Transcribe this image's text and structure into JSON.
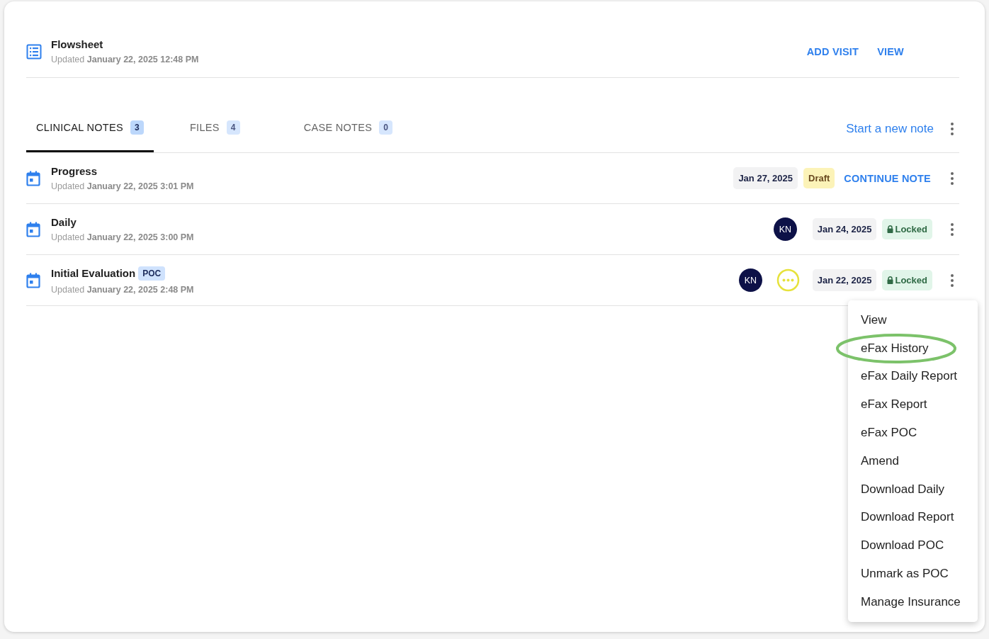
{
  "flowsheet": {
    "title": "Flowsheet",
    "updated": "Updated **January 22, 2025 12:48 PM**",
    "actions": [
      "ADD VISIT",
      "VIEW"
    ]
  },
  "tabs": [
    {
      "label": "CLINICAL NOTES",
      "count": "3",
      "selected": true
    },
    {
      "label": "FILES",
      "count": "4",
      "selected": false
    },
    {
      "label": "CASE NOTES",
      "count": "0",
      "selected": false
    }
  ],
  "new_note": "Start a new note",
  "notes": [
    {
      "title": "Progress",
      "updated": "Updated **January 22, 2025 3:01 PM**",
      "pending": false,
      "date": "Jan 27, 2025",
      "status": {
        "kind": "draft",
        "label": "Draft"
      },
      "action": "CONTINUE NOTE"
    },
    {
      "title": "Daily",
      "updated": "Updated **January 22, 2025 3:00 PM**",
      "avatars": [
        "KN"
      ],
      "pending": false,
      "date": "Jan 24, 2025",
      "status": {
        "kind": "locked",
        "label": "Locked"
      }
    },
    {
      "title": "Initial Evaluation",
      "tag": "POC",
      "updated": "Updated **January 22, 2025 2:48 PM**",
      "avatars": [
        "KN"
      ],
      "pending": true,
      "date": "Jan 22, 2025",
      "status": {
        "kind": "locked",
        "label": "Locked"
      }
    }
  ],
  "menu": [
    {
      "label": "View",
      "circled": false
    },
    {
      "label": "eFax History",
      "circled": true
    },
    {
      "label": "eFax Daily Report",
      "circled": false
    },
    {
      "label": "eFax Report",
      "circled": false
    },
    {
      "label": "eFax POC",
      "circled": false
    },
    {
      "label": "Amend",
      "circled": false
    },
    {
      "label": "Download Daily",
      "circled": false
    },
    {
      "label": "Download Report",
      "circled": false
    },
    {
      "label": "Download POC",
      "circled": false
    },
    {
      "label": "Unmark as POC",
      "circled": false
    },
    {
      "label": "Manage Insurance",
      "circled": false
    }
  ]
}
